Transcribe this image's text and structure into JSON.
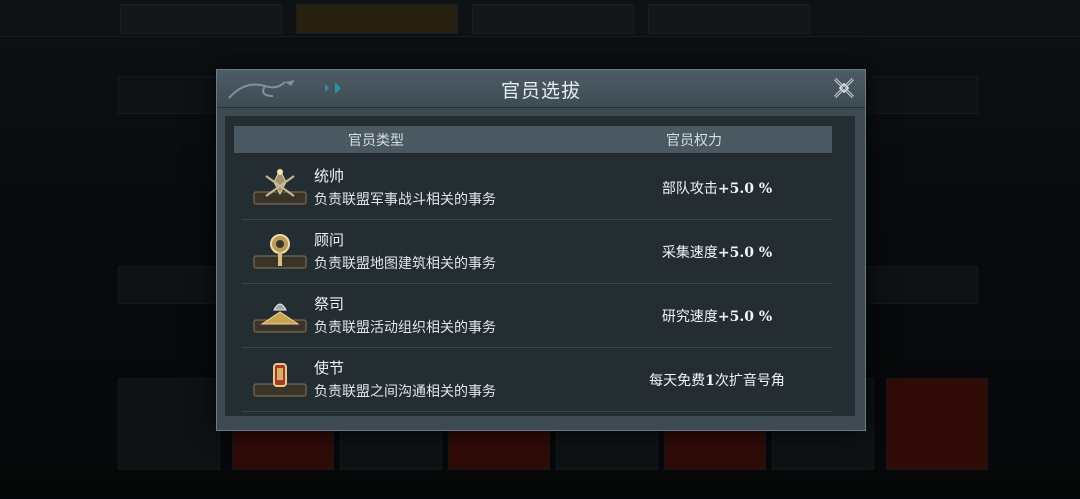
{
  "dialog": {
    "title": "官员选拔",
    "column_type": "官员类型",
    "column_power": "官员权力"
  },
  "officers": [
    {
      "name": "统帅",
      "desc": "负责联盟军事战斗相关的事务",
      "power_prefix": "部队攻击",
      "power_value": "+5.0 %",
      "icon": "commander-crest-icon"
    },
    {
      "name": "顾问",
      "desc": "负责联盟地图建筑相关的事务",
      "power_prefix": "采集速度",
      "power_value": "+5.0 %",
      "icon": "advisor-crest-icon"
    },
    {
      "name": "祭司",
      "desc": "负责联盟活动组织相关的事务",
      "power_prefix": "研究速度",
      "power_value": "+5.0 %",
      "icon": "priest-crest-icon"
    },
    {
      "name": "使节",
      "desc": "负责联盟之间沟通相关的事务",
      "power_prefix": "每天免费",
      "power_value": "1",
      "power_suffix": "次扩音号角",
      "icon": "envoy-crest-icon"
    }
  ]
}
